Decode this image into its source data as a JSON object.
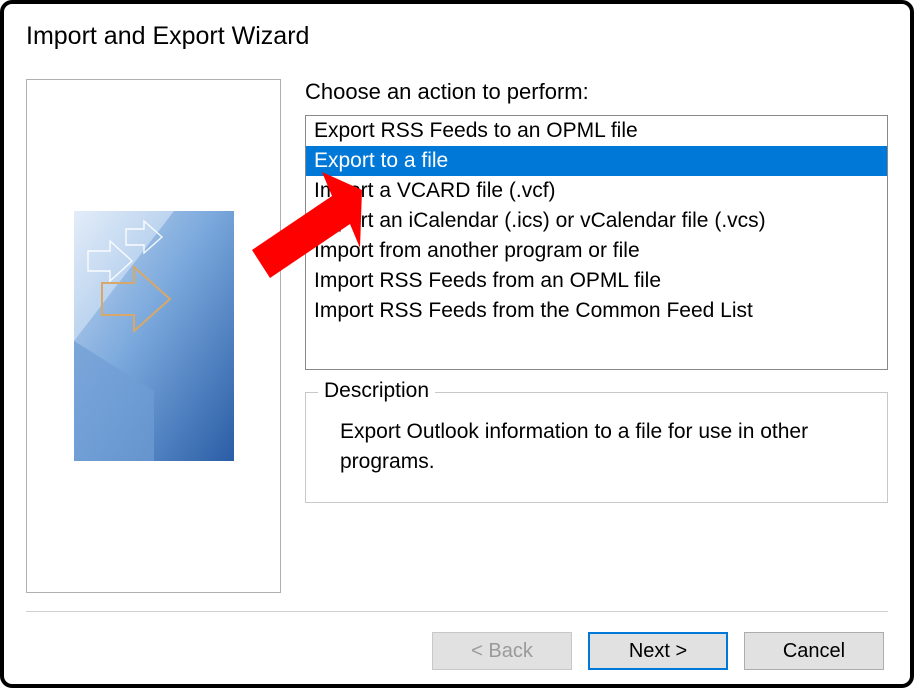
{
  "window_title": "Import and Export Wizard",
  "prompt": "Choose an action to perform:",
  "actions": [
    {
      "label": "Export RSS Feeds to an OPML file",
      "selected": false
    },
    {
      "label": "Export to a file",
      "selected": true
    },
    {
      "label": "Import a VCARD file (.vcf)",
      "selected": false
    },
    {
      "label": "Import an iCalendar (.ics) or vCalendar file (.vcs)",
      "selected": false
    },
    {
      "label": "Import from another program or file",
      "selected": false
    },
    {
      "label": "Import RSS Feeds from an OPML file",
      "selected": false
    },
    {
      "label": "Import RSS Feeds from the Common Feed List",
      "selected": false
    }
  ],
  "description_label": "Description",
  "description_text": "Export Outlook information to a file for use in other programs.",
  "buttons": {
    "back": "< Back",
    "next": "Next >",
    "cancel": "Cancel"
  },
  "annotation": {
    "arrow_color": "#ff0000"
  }
}
